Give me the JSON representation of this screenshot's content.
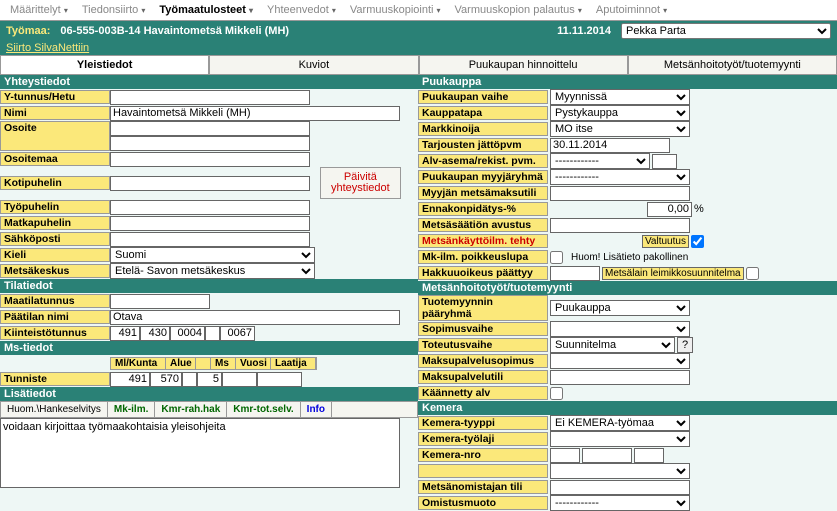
{
  "menu": [
    "Määrittelyt",
    "Tiedonsiirto",
    "Työmaatulosteet",
    "Yhteenvedot",
    "Varmuuskopiointi",
    "Varmuuskopion palautus",
    "Aputoiminnot"
  ],
  "menu_active": 2,
  "header": {
    "tyomaa_lbl": "Työmaa:",
    "tyomaa_val": "06-555-003B-14  Havaintometsä Mikkeli (MH)",
    "date": "11.11.2014",
    "user": "Pekka Parta",
    "link": "Siirto SilvaNettiin"
  },
  "tabs": [
    "Yleistiedot",
    "Kuviot",
    "Puukaupan hinnoittelu",
    "Metsänhoitotyöt/tuotemyynti"
  ],
  "yht": {
    "title": "Yhteystiedot",
    "labels": {
      "ytunnus": "Y-tunnus/Hetu",
      "nimi": "Nimi",
      "osoite": "Osoite",
      "osoitemaa": "Osoitemaa",
      "kotipuhelin": "Kotipuhelin",
      "tyopuhelin": "Työpuhelin",
      "matkapuhelin": "Matkapuhelin",
      "sahkoposti": "Sähköposti",
      "kieli": "Kieli",
      "metsakeskus": "Metsäkeskus"
    },
    "nimi": "Havaintometsä Mikkeli (MH)",
    "kieli": "Suomi",
    "metsakeskus": "Etelä- Savon metsäkeskus",
    "btn1": "Päivitä",
    "btn2": "yhteystiedot"
  },
  "tila": {
    "title": "Tilatiedot",
    "labels": {
      "maatila": "Maatilatunnus",
      "paatila": "Päätilan nimi",
      "kiint": "Kiinteistötunnus"
    },
    "paatila": "Otava",
    "kiint": [
      "491",
      "430",
      "0004",
      "",
      "0067"
    ]
  },
  "ms": {
    "title": "Ms-tiedot",
    "hdr": [
      "Ml/Kunta",
      "Alue",
      "",
      "Ms",
      "Vuosi",
      "Laatija"
    ],
    "tunniste_lbl": "Tunniste",
    "vals": [
      "491",
      "570",
      "",
      "5",
      "",
      ""
    ]
  },
  "lisa": {
    "title": "Lisätiedot",
    "subtabs": [
      "Huom.\\Hankeselvitys",
      "Mk-ilm.",
      "Kmr-rah.hak",
      "Kmr-tot.selv.",
      "Info"
    ],
    "text": "voidaan kirjoittaa työmaakohtaisia yleisohjeita"
  },
  "puu": {
    "title": "Puukauppa",
    "rows": {
      "vaihe": {
        "lbl": "Puukaupan vaihe",
        "val": "Myynnissä"
      },
      "tapa": {
        "lbl": "Kauppatapa",
        "val": "Pystykauppa"
      },
      "markk": {
        "lbl": "Markkinoija",
        "val": "MO itse"
      },
      "tarj": {
        "lbl": "Tarjousten jättöpvm",
        "val": "30.11.2014"
      },
      "alv": {
        "lbl": "Alv-asema/rekist. pvm.",
        "val": "------------"
      },
      "myyj": {
        "lbl": "Puukaupan myyjäryhmä",
        "val": "------------"
      },
      "mtili": {
        "lbl": "Myyjän metsämaksutili"
      },
      "enna": {
        "lbl": "Ennakonpidätys-%",
        "val": "0,00"
      },
      "avustus": {
        "lbl": "Metsäsäätiön avustus"
      },
      "mkt": {
        "lbl": "Metsänkäyttöilm. tehty",
        "val": "Valtuutus"
      },
      "mkp": {
        "lbl": "Mk-ilm. poikkeuslupa",
        "note": "Huom! Lisätieto pakollinen"
      },
      "hakk": {
        "lbl": "Hakkuuoikeus  päättyy",
        "note": "Metsälain leimikkosuunnitelma"
      }
    }
  },
  "mht": {
    "title": "Metsänhoitotyöt/tuotemyynti",
    "rows": {
      "paaryhma": {
        "lbl": "Tuotemyynnin pääryhmä",
        "val": "Puukauppa"
      },
      "sopimus": {
        "lbl": "Sopimusvaihe"
      },
      "toteutus": {
        "lbl": "Toteutusvaihe",
        "val": "Suunnitelma"
      },
      "maksup": {
        "lbl": "Maksupalvelusopimus"
      },
      "maksut": {
        "lbl": "Maksupalvelutili"
      },
      "kaann": {
        "lbl": "Käännetty alv"
      }
    }
  },
  "kem": {
    "title": "Kemera",
    "rows": {
      "tyyppi": {
        "lbl": "Kemera-tyyppi",
        "val": "Ei KEMERA-työmaa"
      },
      "laji": {
        "lbl": "Kemera-työlaji"
      },
      "nro": {
        "lbl": "Kemera-nro"
      },
      "gap": {
        "lbl": "."
      },
      "tili": {
        "lbl": "Metsänomistajan tili"
      },
      "muoto": {
        "lbl": "Omistusmuoto",
        "val": "------------"
      }
    }
  }
}
